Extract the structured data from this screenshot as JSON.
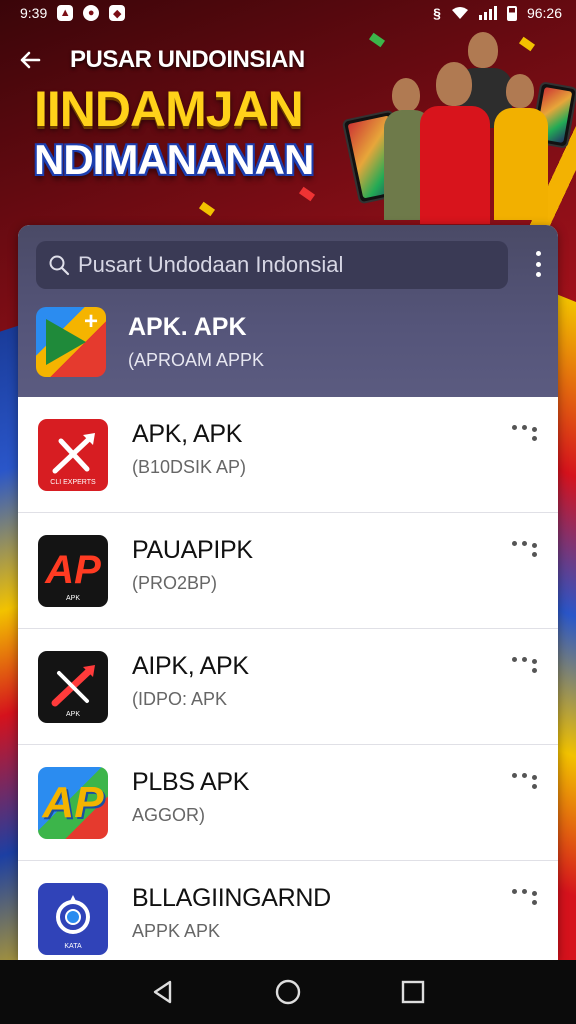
{
  "status_bar": {
    "time": "9:39",
    "icons_left": [
      "photo-icon",
      "circle-icon",
      "bag-icon"
    ],
    "icons_right": [
      "wifi-icon",
      "signal-icon",
      "battery-icon"
    ],
    "clock_right": "96:26"
  },
  "header": {
    "back_icon": "arrow-left-icon",
    "hero_line1": "PUSAR UNDOINSIAN",
    "hero_line2": "IINDAMJAN",
    "hero_line3": "NDIMANANAN"
  },
  "search": {
    "placeholder": "Pusart Undodaan Indonsial",
    "menu_icon": "more-vertical-icon"
  },
  "featured": {
    "title": "APK. APK",
    "subtitle": "(APROAM APPK"
  },
  "apps": [
    {
      "name": "APK, APK",
      "subtitle": "(B10DSIK AP)",
      "icon_label": "CLI EXPERTS",
      "icon_colors": [
        "#d71d22",
        "#ffffff"
      ]
    },
    {
      "name": "PAUAPIPK",
      "subtitle": "(PRO2BP)",
      "icon_label": "APK",
      "icon_colors": [
        "#141414",
        "#ff3b22"
      ]
    },
    {
      "name": "AIPK, APK",
      "subtitle": "(IDPO: APK",
      "icon_label": "APK",
      "icon_colors": [
        "#141414",
        "#ff3b3b"
      ]
    },
    {
      "name": "PLBS APK",
      "subtitle": "AGGOR)",
      "icon_label": "",
      "icon_colors": [
        "#f4b400",
        "#2b8cf0"
      ]
    },
    {
      "name": "BLLAGIINGARND",
      "subtitle": "APPK APK",
      "icon_label": "KATA",
      "icon_colors": [
        "#3043b8",
        "#ffffff"
      ]
    }
  ],
  "nav_bar": [
    "back-triangle-icon",
    "home-circle-icon",
    "recents-square-icon"
  ]
}
